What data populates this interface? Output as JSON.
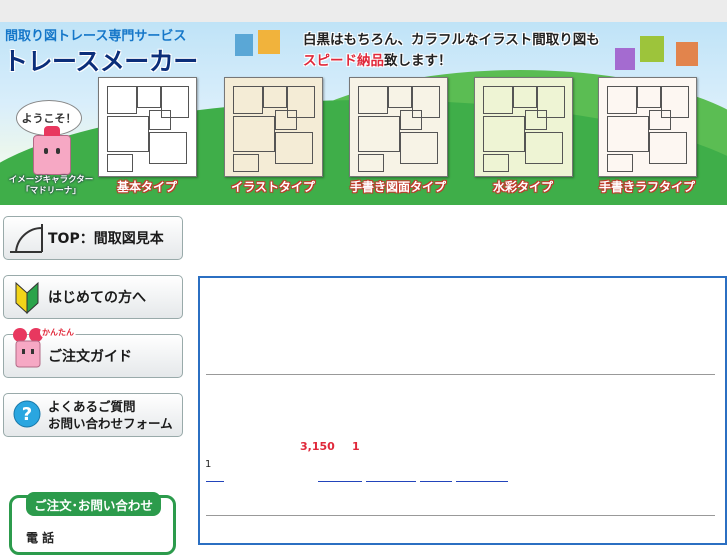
{
  "header": {
    "subtitle": "間取り図トレース専門サービス",
    "title": "トレースメーカー",
    "tagline_1": "白黒はもちろん、カラフルなイラスト間取り図も",
    "tagline_2_red": "スピード納品",
    "tagline_2_rest": "致します！",
    "greeting": "ようこそ！",
    "character_caption_1": "イメージキャラクター",
    "character_caption_2": "「マドリーナ」",
    "plan_types": [
      {
        "label": "基本タイプ",
        "bg": "#ffffff"
      },
      {
        "label": "イラストタイプ",
        "bg": "#f4ecd6"
      },
      {
        "label": "手書き図面タイプ",
        "bg": "#f7f3e6"
      },
      {
        "label": "水彩タイプ",
        "bg": "#eef4d4"
      },
      {
        "label": "手書きラフタイプ",
        "bg": "#fdf7f2"
      }
    ]
  },
  "sidebar": {
    "nav": [
      {
        "label": "TOP：間取図見本",
        "icon": "door-plan-icon"
      },
      {
        "label": "はじめての方へ",
        "icon": "beginner-mark-icon"
      },
      {
        "label": "ご注文ガイド",
        "icon": "madorina-mascot-icon",
        "ruby": "かんたん"
      },
      {
        "label_1": "よくあるご質問",
        "label_2": "お問い合わせフォーム",
        "icon": "question-mark-icon"
      }
    ],
    "contact": {
      "heading": "ご注文･お問い合わせ",
      "phone_label": "電 話"
    }
  },
  "main": {
    "price": "3,150",
    "quantity": "1",
    "note_number": "1"
  },
  "colors": {
    "accent_blue": "#2b6fc2",
    "title_navy": "#0b2e7a",
    "highlight_red": "#e0283a",
    "contact_green": "#2c9b4c",
    "label_outline_red": "#c0392b"
  }
}
